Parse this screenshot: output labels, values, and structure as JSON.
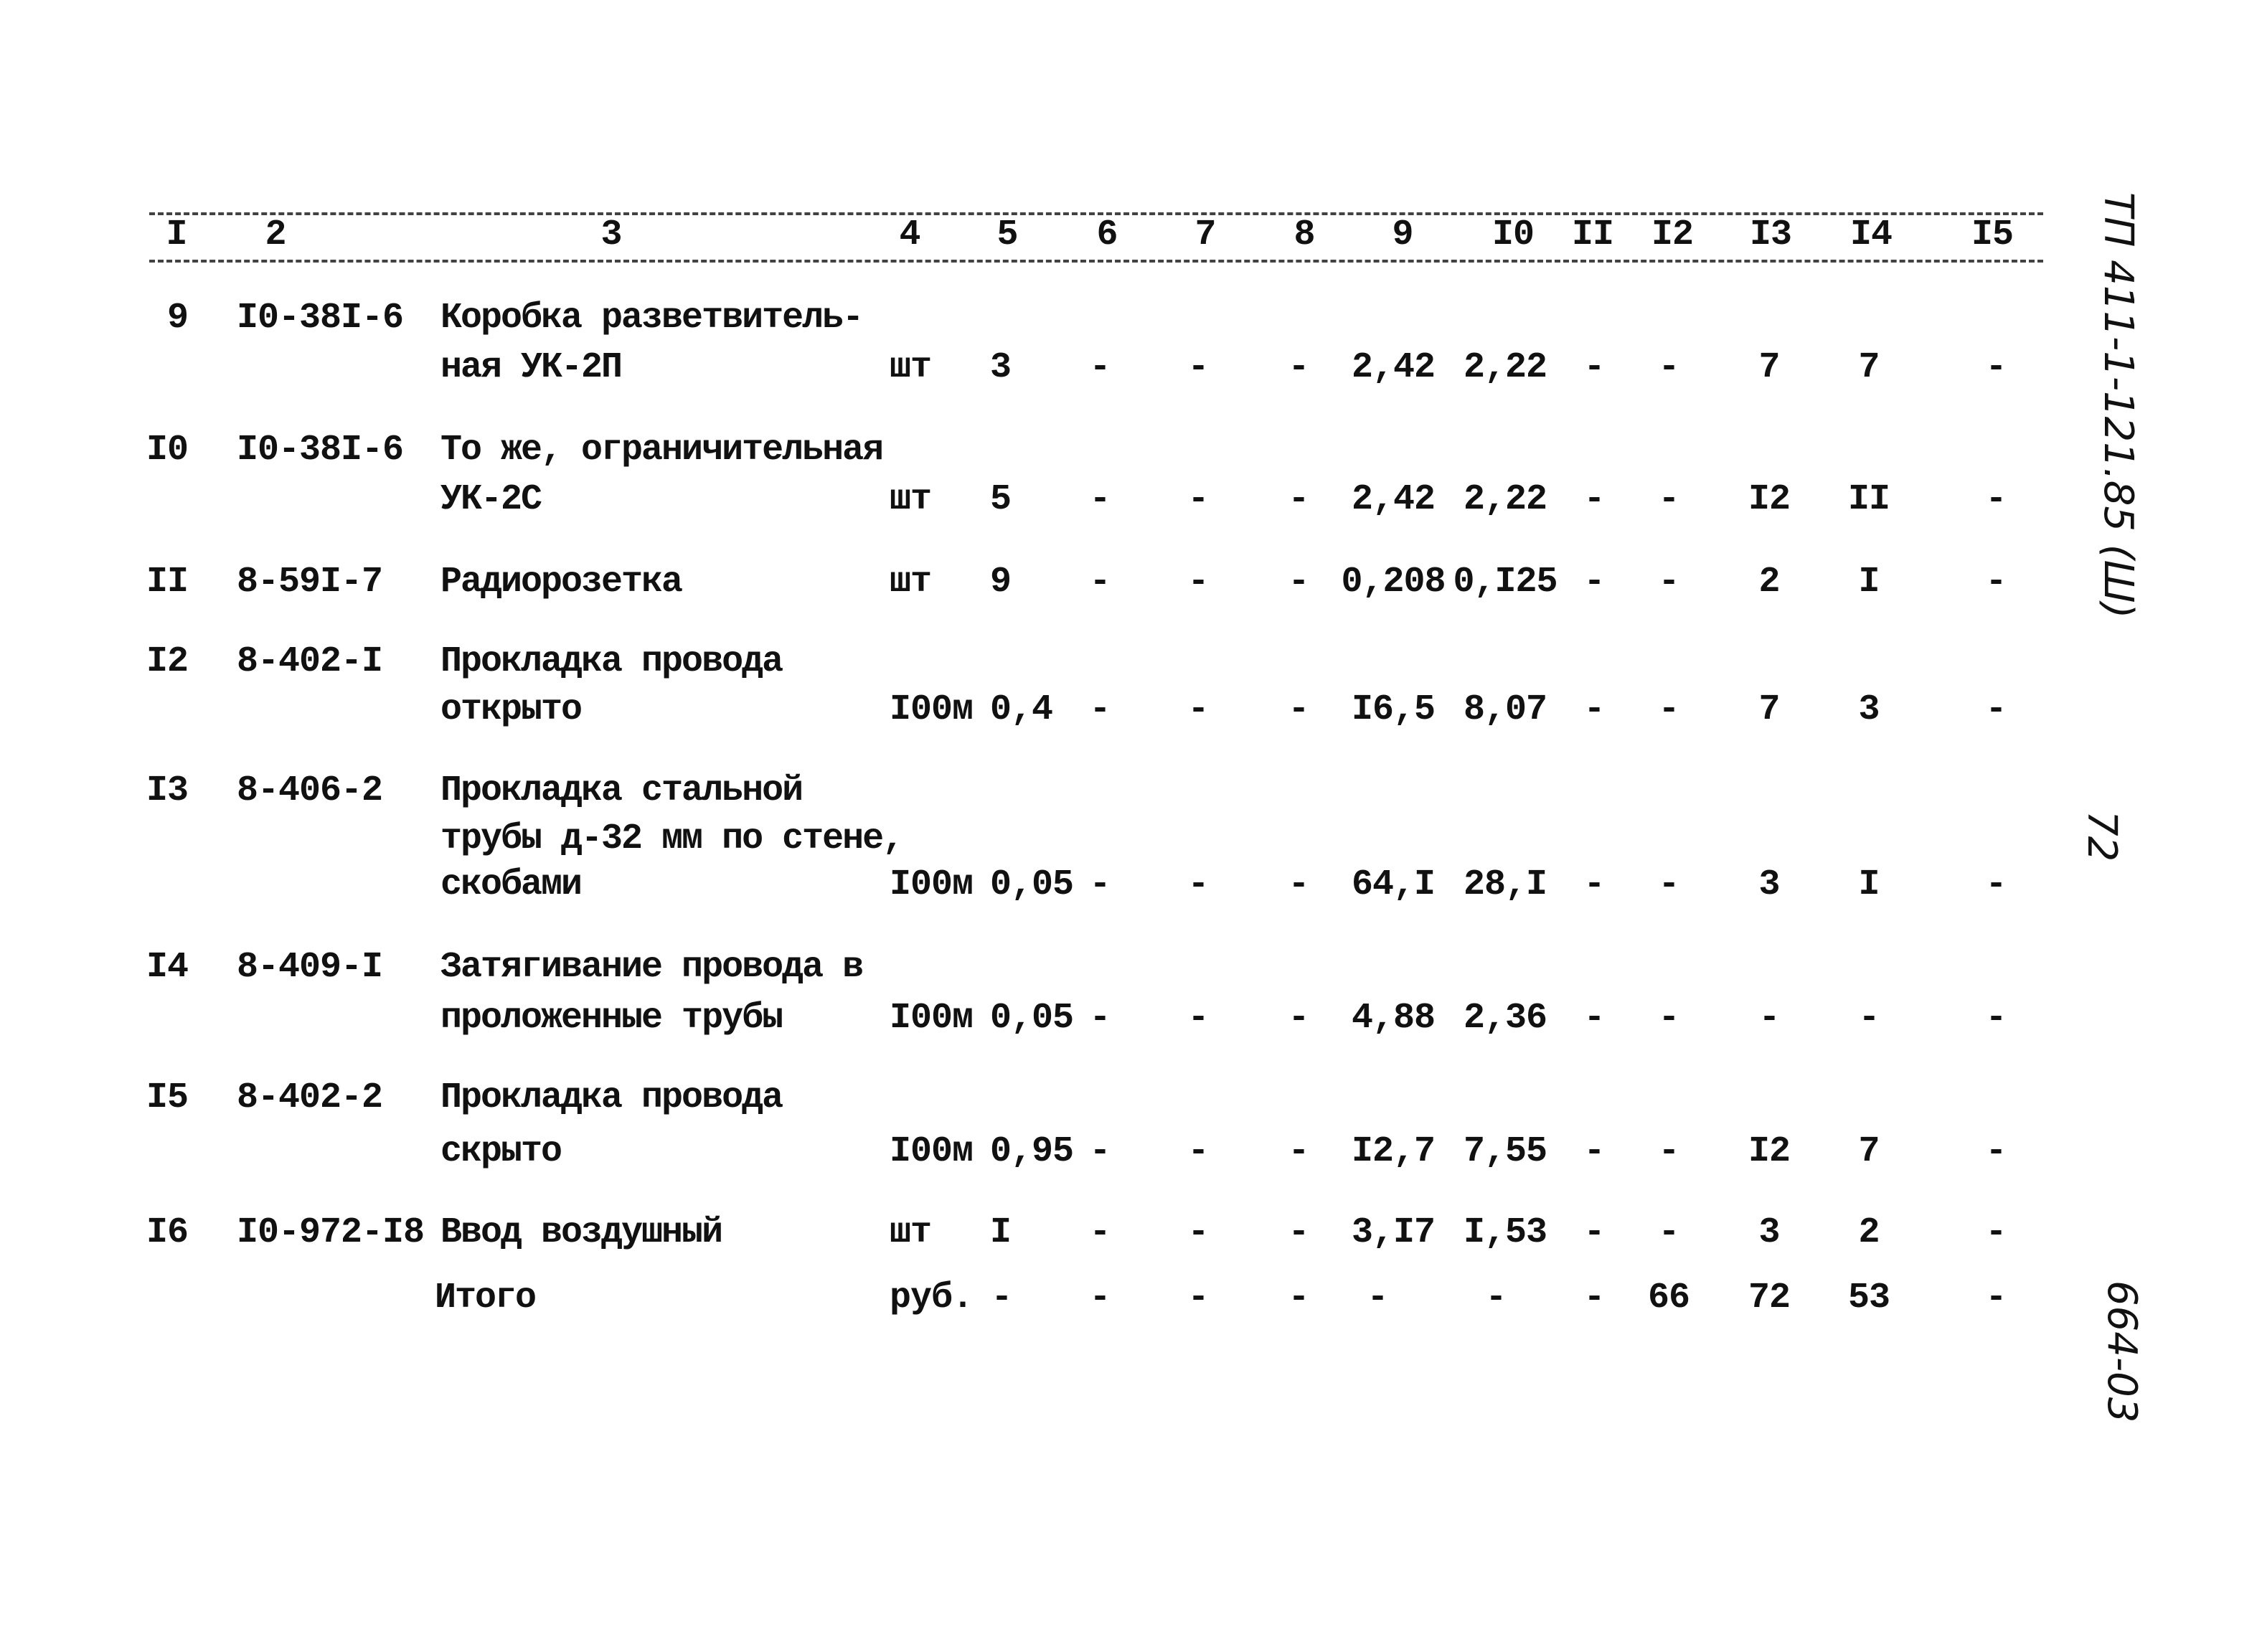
{
  "header": {
    "columns": [
      "I",
      "2",
      "3",
      "4",
      "5",
      "6",
      "7",
      "8",
      "9",
      "I0",
      "II",
      "I2",
      "I3",
      "I4",
      "I5"
    ]
  },
  "rows": [
    {
      "num": "9",
      "code": "I0-38I-6",
      "desc": [
        "Коробка разветвитель-",
        "ная УК-2П"
      ],
      "unit": "шт",
      "qty": "3",
      "c6": "-",
      "c7": "-",
      "c8": "-",
      "c9": "2,42",
      "c10": "2,22",
      "c11": "-",
      "c12": "-",
      "c13": "7",
      "c14": "7",
      "c15": "-"
    },
    {
      "num": "I0",
      "code": "I0-38I-6",
      "desc": [
        "То же, ограничительная",
        "УК-2С"
      ],
      "unit": "шт",
      "qty": "5",
      "c6": "-",
      "c7": "-",
      "c8": "-",
      "c9": "2,42",
      "c10": "2,22",
      "c11": "-",
      "c12": "-",
      "c13": "I2",
      "c14": "II",
      "c15": "-"
    },
    {
      "num": "II",
      "code": "8-59I-7",
      "desc": [
        "Радиорозетка"
      ],
      "unit": "шт",
      "qty": "9",
      "c6": "-",
      "c7": "-",
      "c8": "-",
      "c9": "0,208",
      "c10": "0,I25",
      "c11": "-",
      "c12": "-",
      "c13": "2",
      "c14": "I",
      "c15": "-"
    },
    {
      "num": "I2",
      "code": "8-402-I",
      "desc": [
        "Прокладка провода",
        "открыто"
      ],
      "unit": "I00м",
      "qty": "0,4",
      "c6": "-",
      "c7": "-",
      "c8": "-",
      "c9": "I6,5",
      "c10": "8,07",
      "c11": "-",
      "c12": "-",
      "c13": "7",
      "c14": "3",
      "c15": "-"
    },
    {
      "num": "I3",
      "code": "8-406-2",
      "desc": [
        "Прокладка стальной",
        "трубы д-32 мм по стене,",
        "скобами"
      ],
      "unit": "I00м",
      "qty": "0,05",
      "c6": "-",
      "c7": "-",
      "c8": "-",
      "c9": "64,I",
      "c10": "28,I",
      "c11": "-",
      "c12": "-",
      "c13": "3",
      "c14": "I",
      "c15": "-"
    },
    {
      "num": "I4",
      "code": "8-409-I",
      "desc": [
        "Затягивание провода в",
        "проложенные трубы"
      ],
      "unit": "I00м",
      "qty": "0,05",
      "c6": "-",
      "c7": "-",
      "c8": "-",
      "c9": "4,88",
      "c10": "2,36",
      "c11": "-",
      "c12": "-",
      "c13": "-",
      "c14": "-",
      "c15": "-"
    },
    {
      "num": "I5",
      "code": "8-402-2",
      "desc": [
        "Прокладка провода",
        "скрыто"
      ],
      "unit": "I00м",
      "qty": "0,95",
      "c6": "-",
      "c7": "-",
      "c8": "-",
      "c9": "I2,7",
      "c10": "7,55",
      "c11": "-",
      "c12": "-",
      "c13": "I2",
      "c14": "7",
      "c15": "-"
    },
    {
      "num": "I6",
      "code": "I0-972-I8",
      "desc": [
        "Ввод воздушный"
      ],
      "unit": "шт",
      "qty": "I",
      "c6": "-",
      "c7": "-",
      "c8": "-",
      "c9": "3,I7",
      "c10": "I,53",
      "c11": "-",
      "c12": "-",
      "c13": "3",
      "c14": "2",
      "c15": "-"
    }
  ],
  "total": {
    "label": "Итого",
    "unit": "руб.",
    "c5": "-",
    "c6": "-",
    "c7": "-",
    "c8": "-",
    "c9": "-",
    "c10": "-",
    "c11": "-",
    "c12": "66",
    "c13": "72",
    "c14": "53",
    "c15": "-"
  },
  "side": {
    "doc_code": "ТП 411-1-121.85 (Ш)",
    "page_number": "72",
    "inventory": "664-03"
  }
}
